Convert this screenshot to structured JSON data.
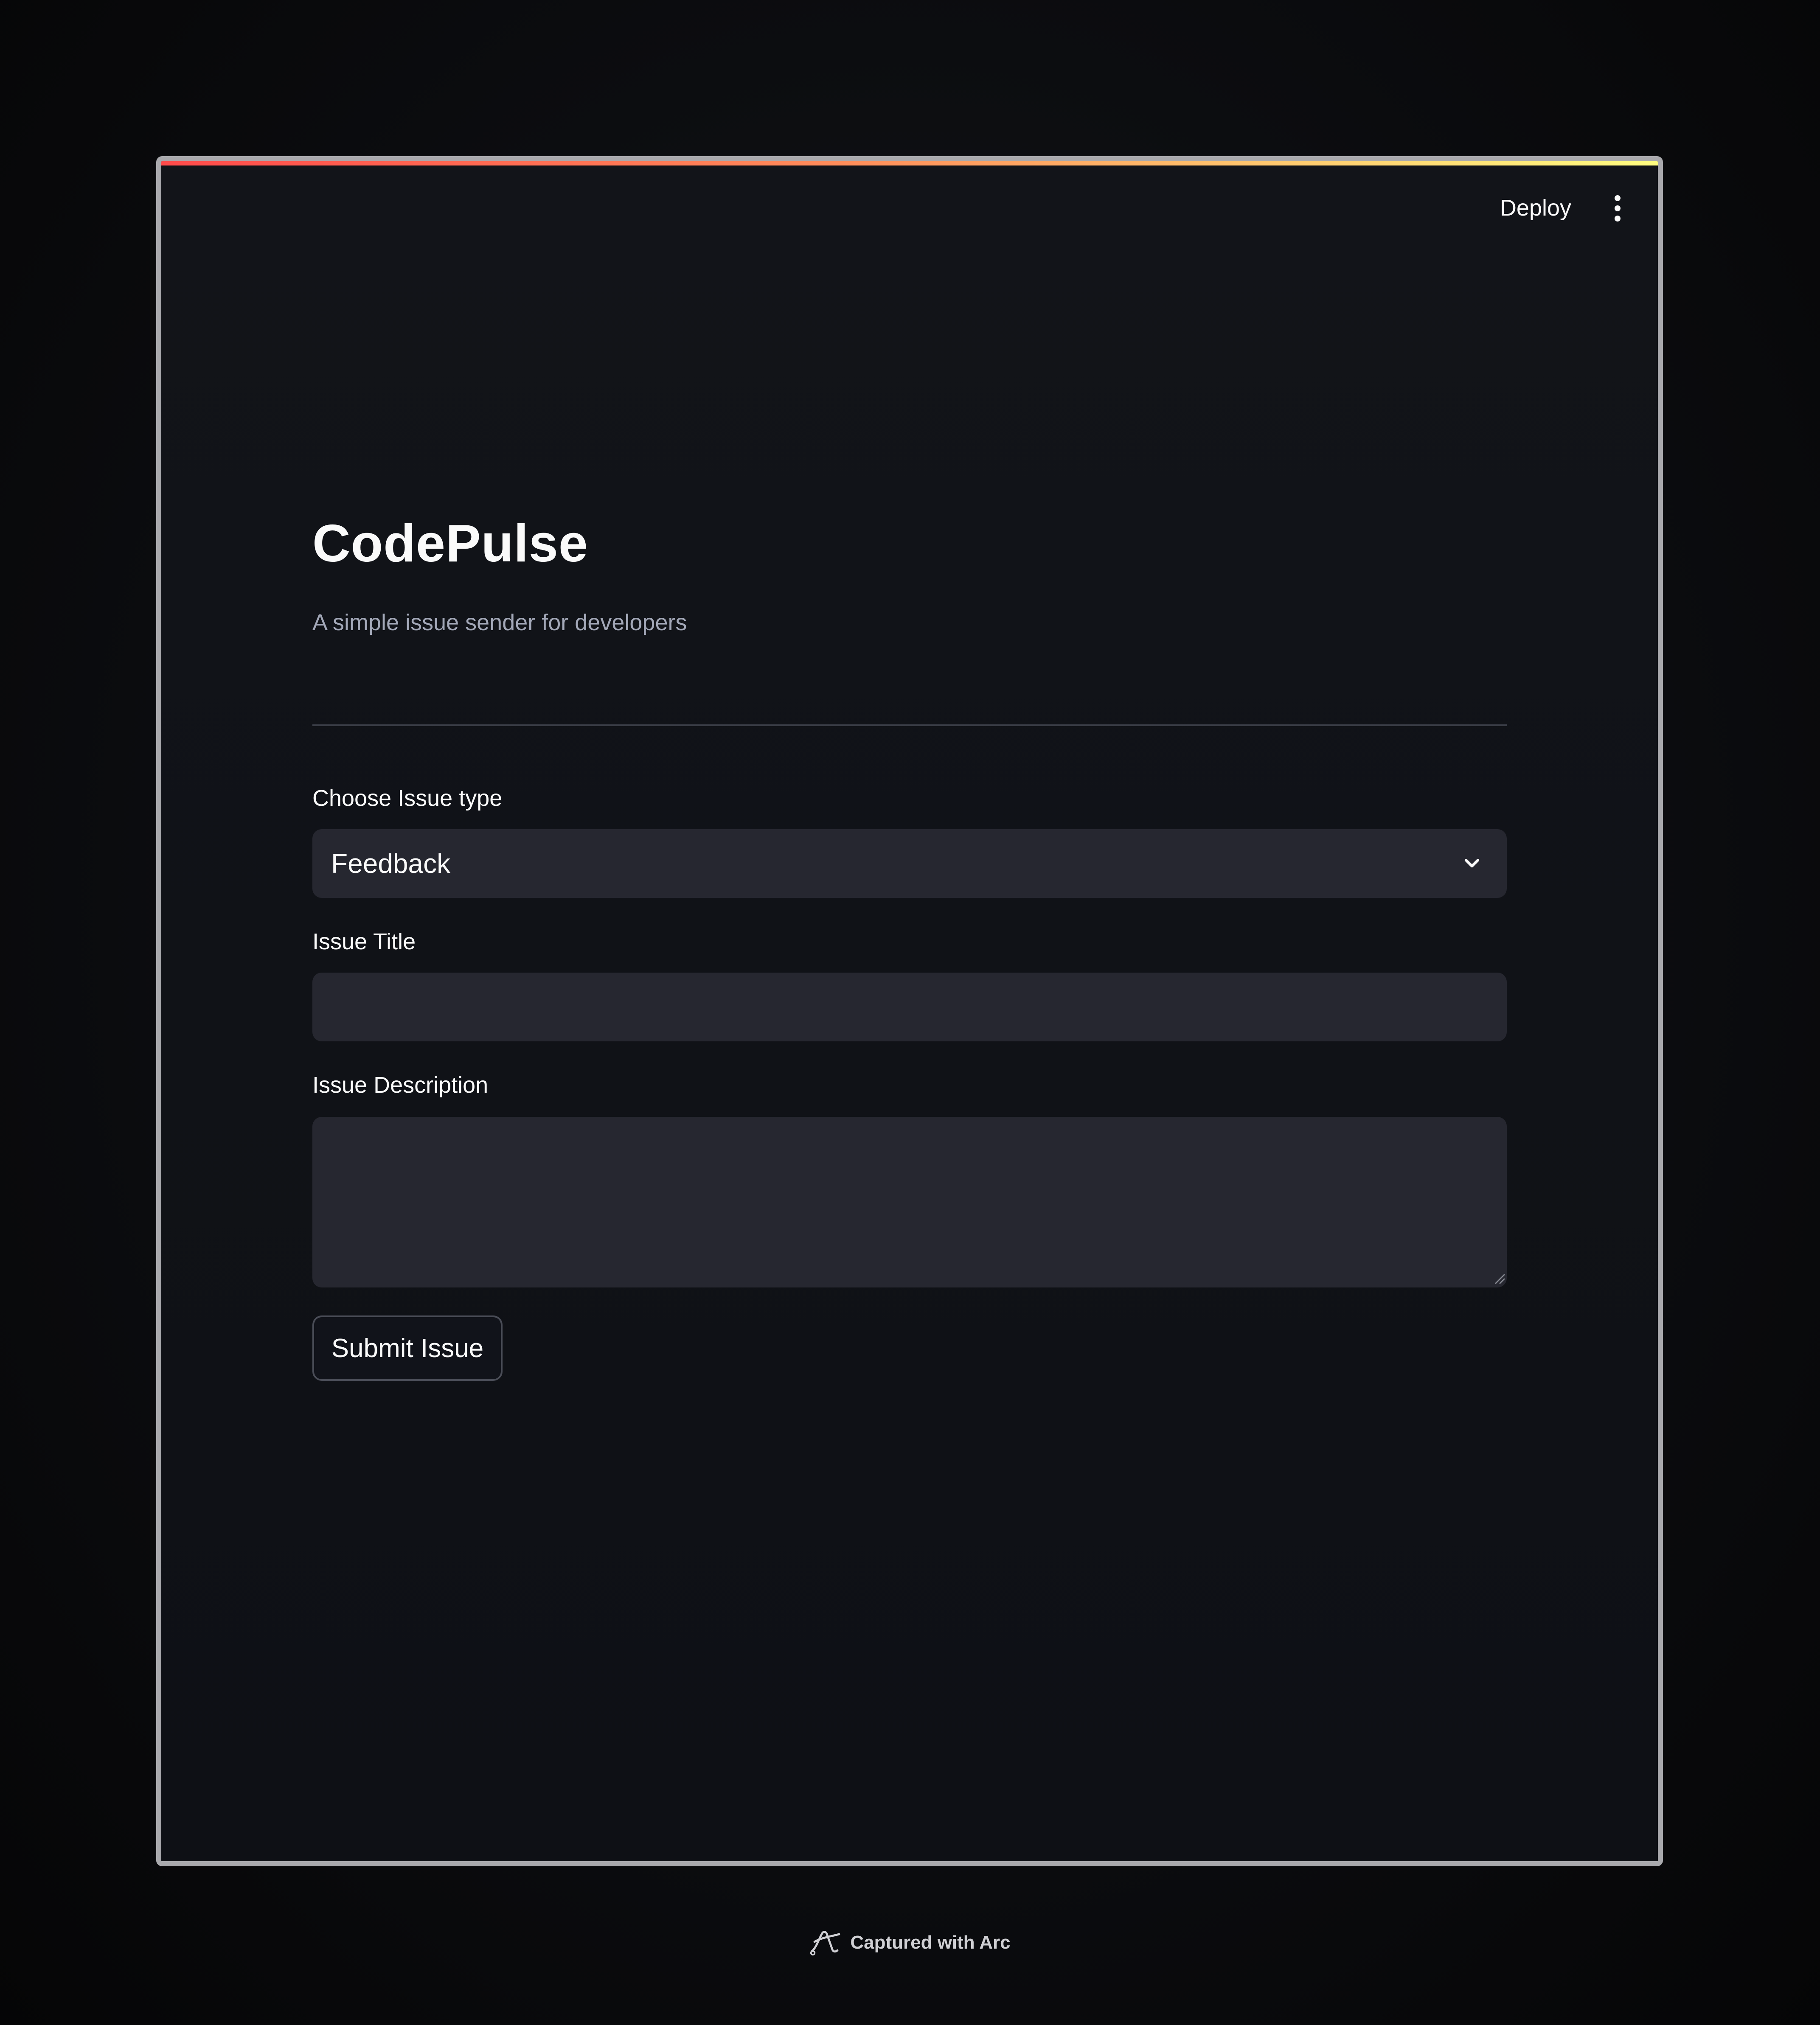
{
  "header": {
    "deploy_label": "Deploy",
    "menu_icon": "more-vertical-icon"
  },
  "colors": {
    "accent_gradient_start": "#ff4b4b",
    "accent_gradient_end": "#fffd80",
    "background": "#0e1117",
    "field_background": "#262730",
    "text": "#fafafa",
    "muted_text": "#a3a8b8"
  },
  "app": {
    "title": "CodePulse",
    "subtitle": "A simple issue sender for developers"
  },
  "form": {
    "issue_type": {
      "label": "Choose Issue type",
      "selected": "Feedback",
      "icon": "chevron-down-icon"
    },
    "issue_title": {
      "label": "Issue Title",
      "value": ""
    },
    "issue_description": {
      "label": "Issue Description",
      "value": ""
    },
    "submit_label": "Submit Issue"
  },
  "footer": {
    "text": "Captured with Arc",
    "icon": "arc-logo-icon"
  }
}
